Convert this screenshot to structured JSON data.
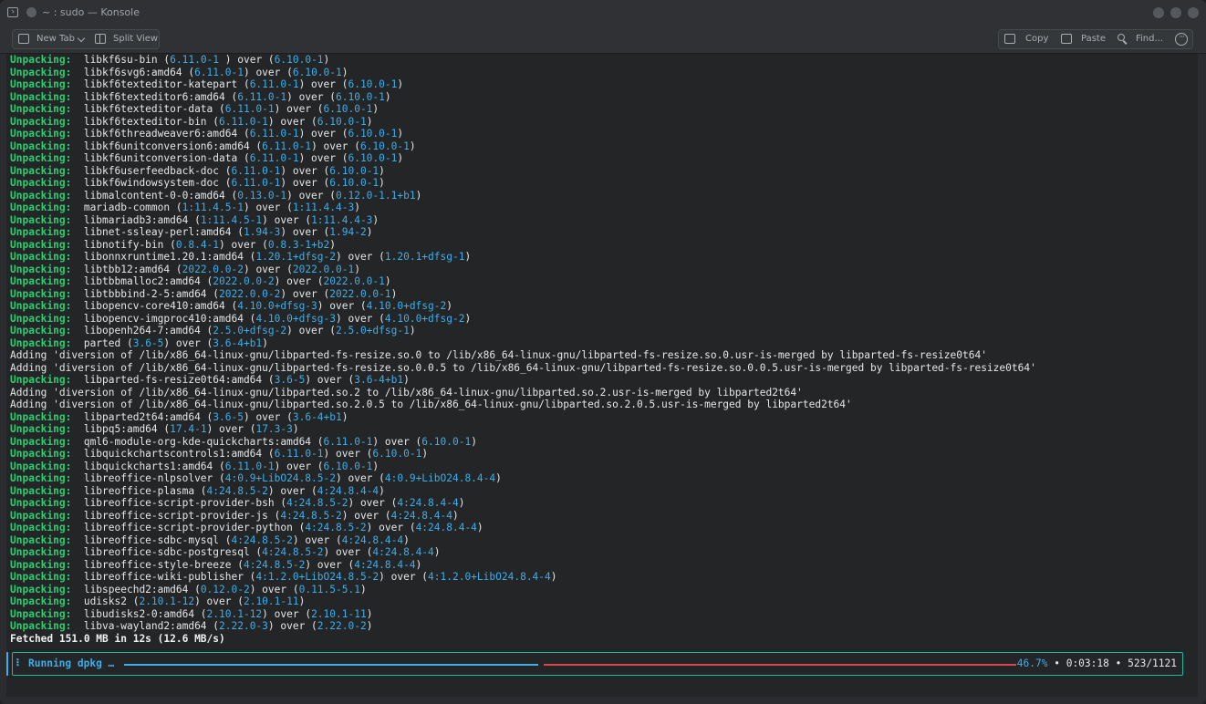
{
  "window": {
    "title": "~ : sudo — Konsole"
  },
  "toolbar": {
    "new_tab": "New Tab",
    "split_view": "Split View",
    "copy": "Copy",
    "paste": "Paste",
    "find": "Find..."
  },
  "terminal": {
    "lines": [
      [
        [
          "kw",
          "Unpacking:"
        ],
        [
          "",
          "  libkf6su-bin ("
        ],
        [
          "ver",
          "6.11.0-1"
        ],
        [
          "",
          " ) over ("
        ],
        [
          "ver",
          "6.10.0-1"
        ],
        [
          "",
          ")"
        ]
      ],
      [
        [
          "kw",
          "Unpacking:"
        ],
        [
          "",
          "  libkf6svg6:amd64 ("
        ],
        [
          "ver",
          "6.11.0-1"
        ],
        [
          "",
          ") over ("
        ],
        [
          "ver",
          "6.10.0-1"
        ],
        [
          "",
          ")"
        ]
      ],
      [
        [
          "kw",
          "Unpacking:"
        ],
        [
          "",
          "  libkf6texteditor-katepart ("
        ],
        [
          "ver",
          "6.11.0-1"
        ],
        [
          "",
          ") over ("
        ],
        [
          "ver",
          "6.10.0-1"
        ],
        [
          "",
          ")"
        ]
      ],
      [
        [
          "kw",
          "Unpacking:"
        ],
        [
          "",
          "  libkf6texteditor6:amd64 ("
        ],
        [
          "ver",
          "6.11.0-1"
        ],
        [
          "",
          ") over ("
        ],
        [
          "ver",
          "6.10.0-1"
        ],
        [
          "",
          ")"
        ]
      ],
      [
        [
          "kw",
          "Unpacking:"
        ],
        [
          "",
          "  libkf6texteditor-data ("
        ],
        [
          "ver",
          "6.11.0-1"
        ],
        [
          "",
          ") over ("
        ],
        [
          "ver",
          "6.10.0-1"
        ],
        [
          "",
          ")"
        ]
      ],
      [
        [
          "kw",
          "Unpacking:"
        ],
        [
          "",
          "  libkf6texteditor-bin ("
        ],
        [
          "ver",
          "6.11.0-1"
        ],
        [
          "",
          ") over ("
        ],
        [
          "ver",
          "6.10.0-1"
        ],
        [
          "",
          ")"
        ]
      ],
      [
        [
          "kw",
          "Unpacking:"
        ],
        [
          "",
          "  libkf6threadweaver6:amd64 ("
        ],
        [
          "ver",
          "6.11.0-1"
        ],
        [
          "",
          ") over ("
        ],
        [
          "ver",
          "6.10.0-1"
        ],
        [
          "",
          ")"
        ]
      ],
      [
        [
          "kw",
          "Unpacking:"
        ],
        [
          "",
          "  libkf6unitconversion6:amd64 ("
        ],
        [
          "ver",
          "6.11.0-1"
        ],
        [
          "",
          ") over ("
        ],
        [
          "ver",
          "6.10.0-1"
        ],
        [
          "",
          ")"
        ]
      ],
      [
        [
          "kw",
          "Unpacking:"
        ],
        [
          "",
          "  libkf6unitconversion-data ("
        ],
        [
          "ver",
          "6.11.0-1"
        ],
        [
          "",
          ") over ("
        ],
        [
          "ver",
          "6.10.0-1"
        ],
        [
          "",
          ")"
        ]
      ],
      [
        [
          "kw",
          "Unpacking:"
        ],
        [
          "",
          "  libkf6userfeedback-doc ("
        ],
        [
          "ver",
          "6.11.0-1"
        ],
        [
          "",
          ") over ("
        ],
        [
          "ver",
          "6.10.0-1"
        ],
        [
          "",
          ")"
        ]
      ],
      [
        [
          "kw",
          "Unpacking:"
        ],
        [
          "",
          "  libkf6windowsystem-doc ("
        ],
        [
          "ver",
          "6.11.0-1"
        ],
        [
          "",
          ") over ("
        ],
        [
          "ver",
          "6.10.0-1"
        ],
        [
          "",
          ")"
        ]
      ],
      [
        [
          "kw",
          "Unpacking:"
        ],
        [
          "",
          "  libmalcontent-0-0:amd64 ("
        ],
        [
          "ver",
          "0.13.0-1"
        ],
        [
          "",
          ") over ("
        ],
        [
          "ver",
          "0.12.0-1.1+b1"
        ],
        [
          "",
          ")"
        ]
      ],
      [
        [
          "kw",
          "Unpacking:"
        ],
        [
          "",
          "  mariadb-common ("
        ],
        [
          "ver",
          "1:11.4.5-1"
        ],
        [
          "",
          ") over ("
        ],
        [
          "ver",
          "1:11.4.4-3"
        ],
        [
          "",
          ")"
        ]
      ],
      [
        [
          "kw",
          "Unpacking:"
        ],
        [
          "",
          "  libmariadb3:amd64 ("
        ],
        [
          "ver",
          "1:11.4.5-1"
        ],
        [
          "",
          ") over ("
        ],
        [
          "ver",
          "1:11.4.4-3"
        ],
        [
          "",
          ")"
        ]
      ],
      [
        [
          "kw",
          "Unpacking:"
        ],
        [
          "",
          "  libnet-ssleay-perl:amd64 ("
        ],
        [
          "ver",
          "1.94-3"
        ],
        [
          "",
          ") over ("
        ],
        [
          "ver",
          "1.94-2"
        ],
        [
          "",
          ")"
        ]
      ],
      [
        [
          "kw",
          "Unpacking:"
        ],
        [
          "",
          "  libnotify-bin ("
        ],
        [
          "ver",
          "0.8.4-1"
        ],
        [
          "",
          ") over ("
        ],
        [
          "ver",
          "0.8.3-1+b2"
        ],
        [
          "",
          ")"
        ]
      ],
      [
        [
          "kw",
          "Unpacking:"
        ],
        [
          "",
          "  libonnxruntime1.20.1:amd64 ("
        ],
        [
          "ver",
          "1.20.1+dfsg-2"
        ],
        [
          "",
          ") over ("
        ],
        [
          "ver",
          "1.20.1+dfsg-1"
        ],
        [
          "",
          ")"
        ]
      ],
      [
        [
          "kw",
          "Unpacking:"
        ],
        [
          "",
          "  libtbb12:amd64 ("
        ],
        [
          "ver",
          "2022.0.0-2"
        ],
        [
          "",
          ") over ("
        ],
        [
          "ver",
          "2022.0.0-1"
        ],
        [
          "",
          ")"
        ]
      ],
      [
        [
          "kw",
          "Unpacking:"
        ],
        [
          "",
          "  libtbbmalloc2:amd64 ("
        ],
        [
          "ver",
          "2022.0.0-2"
        ],
        [
          "",
          ") over ("
        ],
        [
          "ver",
          "2022.0.0-1"
        ],
        [
          "",
          ")"
        ]
      ],
      [
        [
          "kw",
          "Unpacking:"
        ],
        [
          "",
          "  libtbbbind-2-5:amd64 ("
        ],
        [
          "ver",
          "2022.0.0-2"
        ],
        [
          "",
          ") over ("
        ],
        [
          "ver",
          "2022.0.0-1"
        ],
        [
          "",
          ")"
        ]
      ],
      [
        [
          "kw",
          "Unpacking:"
        ],
        [
          "",
          "  libopencv-core410:amd64 ("
        ],
        [
          "ver",
          "4.10.0+dfsg-3"
        ],
        [
          "",
          ") over ("
        ],
        [
          "ver",
          "4.10.0+dfsg-2"
        ],
        [
          "",
          ")"
        ]
      ],
      [
        [
          "kw",
          "Unpacking:"
        ],
        [
          "",
          "  libopencv-imgproc410:amd64 ("
        ],
        [
          "ver",
          "4.10.0+dfsg-3"
        ],
        [
          "",
          ") over ("
        ],
        [
          "ver",
          "4.10.0+dfsg-2"
        ],
        [
          "",
          ")"
        ]
      ],
      [
        [
          "kw",
          "Unpacking:"
        ],
        [
          "",
          "  libopenh264-7:amd64 ("
        ],
        [
          "ver",
          "2.5.0+dfsg-2"
        ],
        [
          "",
          ") over ("
        ],
        [
          "ver",
          "2.5.0+dfsg-1"
        ],
        [
          "",
          ")"
        ]
      ],
      [
        [
          "kw",
          "Unpacking:"
        ],
        [
          "",
          "  parted ("
        ],
        [
          "ver",
          "3.6-5"
        ],
        [
          "",
          ") over ("
        ],
        [
          "ver",
          "3.6-4+b1"
        ],
        [
          "",
          ")"
        ]
      ],
      [
        [
          "",
          "Adding 'diversion of /lib/x86_64-linux-gnu/libparted-fs-resize.so.0 to /lib/x86_64-linux-gnu/libparted-fs-resize.so.0.usr-is-merged by libparted-fs-resize0t64'"
        ]
      ],
      [
        [
          "",
          "Adding 'diversion of /lib/x86_64-linux-gnu/libparted-fs-resize.so.0.0.5 to /lib/x86_64-linux-gnu/libparted-fs-resize.so.0.0.5.usr-is-merged by libparted-fs-resize0t64'"
        ]
      ],
      [
        [
          "kw",
          "Unpacking:"
        ],
        [
          "",
          "  libparted-fs-resize0t64:amd64 ("
        ],
        [
          "ver",
          "3.6-5"
        ],
        [
          "",
          ") over ("
        ],
        [
          "ver",
          "3.6-4+b1"
        ],
        [
          "",
          ")"
        ]
      ],
      [
        [
          "",
          "Adding 'diversion of /lib/x86_64-linux-gnu/libparted.so.2 to /lib/x86_64-linux-gnu/libparted.so.2.usr-is-merged by libparted2t64'"
        ]
      ],
      [
        [
          "",
          "Adding 'diversion of /lib/x86_64-linux-gnu/libparted.so.2.0.5 to /lib/x86_64-linux-gnu/libparted.so.2.0.5.usr-is-merged by libparted2t64'"
        ]
      ],
      [
        [
          "kw",
          "Unpacking:"
        ],
        [
          "",
          "  libparted2t64:amd64 ("
        ],
        [
          "ver",
          "3.6-5"
        ],
        [
          "",
          ") over ("
        ],
        [
          "ver",
          "3.6-4+b1"
        ],
        [
          "",
          ")"
        ]
      ],
      [
        [
          "kw",
          "Unpacking:"
        ],
        [
          "",
          "  libpq5:amd64 ("
        ],
        [
          "ver",
          "17.4-1"
        ],
        [
          "",
          ") over ("
        ],
        [
          "ver",
          "17.3-3"
        ],
        [
          "",
          ")"
        ]
      ],
      [
        [
          "kw",
          "Unpacking:"
        ],
        [
          "",
          "  qml6-module-org-kde-quickcharts:amd64 ("
        ],
        [
          "ver",
          "6.11.0-1"
        ],
        [
          "",
          ") over ("
        ],
        [
          "ver",
          "6.10.0-1"
        ],
        [
          "",
          ")"
        ]
      ],
      [
        [
          "kw",
          "Unpacking:"
        ],
        [
          "",
          "  libquickchartscontrols1:amd64 ("
        ],
        [
          "ver",
          "6.11.0-1"
        ],
        [
          "",
          ") over ("
        ],
        [
          "ver",
          "6.10.0-1"
        ],
        [
          "",
          ")"
        ]
      ],
      [
        [
          "kw",
          "Unpacking:"
        ],
        [
          "",
          "  libquickcharts1:amd64 ("
        ],
        [
          "ver",
          "6.11.0-1"
        ],
        [
          "",
          ") over ("
        ],
        [
          "ver",
          "6.10.0-1"
        ],
        [
          "",
          ")"
        ]
      ],
      [
        [
          "kw",
          "Unpacking:"
        ],
        [
          "",
          "  libreoffice-nlpsolver ("
        ],
        [
          "ver",
          "4:0.9+LibO24.8.5-2"
        ],
        [
          "",
          ") over ("
        ],
        [
          "ver",
          "4:0.9+LibO24.8.4-4"
        ],
        [
          "",
          ")"
        ]
      ],
      [
        [
          "kw",
          "Unpacking:"
        ],
        [
          "",
          "  libreoffice-plasma ("
        ],
        [
          "ver",
          "4:24.8.5-2"
        ],
        [
          "",
          ") over ("
        ],
        [
          "ver",
          "4:24.8.4-4"
        ],
        [
          "",
          ")"
        ]
      ],
      [
        [
          "kw",
          "Unpacking:"
        ],
        [
          "",
          "  libreoffice-script-provider-bsh ("
        ],
        [
          "ver",
          "4:24.8.5-2"
        ],
        [
          "",
          ") over ("
        ],
        [
          "ver",
          "4:24.8.4-4"
        ],
        [
          "",
          ")"
        ]
      ],
      [
        [
          "kw",
          "Unpacking:"
        ],
        [
          "",
          "  libreoffice-script-provider-js ("
        ],
        [
          "ver",
          "4:24.8.5-2"
        ],
        [
          "",
          ") over ("
        ],
        [
          "ver",
          "4:24.8.4-4"
        ],
        [
          "",
          ")"
        ]
      ],
      [
        [
          "kw",
          "Unpacking:"
        ],
        [
          "",
          "  libreoffice-script-provider-python ("
        ],
        [
          "ver",
          "4:24.8.5-2"
        ],
        [
          "",
          ") over ("
        ],
        [
          "ver",
          "4:24.8.4-4"
        ],
        [
          "",
          ")"
        ]
      ],
      [
        [
          "kw",
          "Unpacking:"
        ],
        [
          "",
          "  libreoffice-sdbc-mysql ("
        ],
        [
          "ver",
          "4:24.8.5-2"
        ],
        [
          "",
          ") over ("
        ],
        [
          "ver",
          "4:24.8.4-4"
        ],
        [
          "",
          ")"
        ]
      ],
      [
        [
          "kw",
          "Unpacking:"
        ],
        [
          "",
          "  libreoffice-sdbc-postgresql ("
        ],
        [
          "ver",
          "4:24.8.5-2"
        ],
        [
          "",
          ") over ("
        ],
        [
          "ver",
          "4:24.8.4-4"
        ],
        [
          "",
          ")"
        ]
      ],
      [
        [
          "kw",
          "Unpacking:"
        ],
        [
          "",
          "  libreoffice-style-breeze ("
        ],
        [
          "ver",
          "4:24.8.5-2"
        ],
        [
          "",
          ") over ("
        ],
        [
          "ver",
          "4:24.8.4-4"
        ],
        [
          "",
          ")"
        ]
      ],
      [
        [
          "kw",
          "Unpacking:"
        ],
        [
          "",
          "  libreoffice-wiki-publisher ("
        ],
        [
          "ver",
          "4:1.2.0+LibO24.8.5-2"
        ],
        [
          "",
          ") over ("
        ],
        [
          "ver",
          "4:1.2.0+LibO24.8.4-4"
        ],
        [
          "",
          ")"
        ]
      ],
      [
        [
          "kw",
          "Unpacking:"
        ],
        [
          "",
          "  libspeechd2:amd64 ("
        ],
        [
          "ver",
          "0.12.0-2"
        ],
        [
          "",
          ") over ("
        ],
        [
          "ver",
          "0.11.5-5.1"
        ],
        [
          "",
          ")"
        ]
      ],
      [
        [
          "kw",
          "Unpacking:"
        ],
        [
          "",
          "  udisks2 ("
        ],
        [
          "ver",
          "2.10.1-12"
        ],
        [
          "",
          ") over ("
        ],
        [
          "ver",
          "2.10.1-11"
        ],
        [
          "",
          ")"
        ]
      ],
      [
        [
          "kw",
          "Unpacking:"
        ],
        [
          "",
          "  libudisks2-0:amd64 ("
        ],
        [
          "ver",
          "2.10.1-12"
        ],
        [
          "",
          ") over ("
        ],
        [
          "ver",
          "2.10.1-11"
        ],
        [
          "",
          ")"
        ]
      ],
      [
        [
          "kw",
          "Unpacking:"
        ],
        [
          "",
          "  libva-wayland2:amd64 ("
        ],
        [
          "ver",
          "2.22.0-3"
        ],
        [
          "",
          ") over ("
        ],
        [
          "ver",
          "2.22.0-2"
        ],
        [
          "",
          ")"
        ]
      ],
      [
        [
          "bold",
          "Fetched 151.0 MB in 12s (12.6 MB/s)"
        ]
      ]
    ],
    "progress": {
      "spinner": "⠇",
      "label": "Running dpkg …",
      "fraction": 0.467,
      "percent": "46.7%",
      "elapsed": "0:03:18",
      "count": "523/1121",
      "sep": "•"
    }
  },
  "colors": {
    "keyword": "#2ecc71",
    "version": "#3daee9",
    "progress_done": "#3daee9",
    "progress_remaining": "#da4453",
    "progress_border": "#1abc9c"
  }
}
